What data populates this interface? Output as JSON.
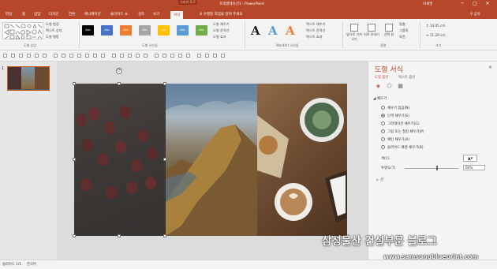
{
  "window": {
    "context_tab": "그리기 도구",
    "title": "프레젠테이션1 - PowerPoint",
    "user": "이세영",
    "min": "─",
    "max": "□",
    "close": "✕"
  },
  "tabs": [
    "파일",
    "홈",
    "삽입",
    "디자인",
    "전환",
    "애니메이션",
    "슬라이드 쇼",
    "검토",
    "보기",
    "서식"
  ],
  "tell_me": "수행할 작업을 알려 주세요",
  "share": "공유",
  "ribbon": {
    "shape_fill": "도형 채우기",
    "shape_outline": "도형 윤곽선",
    "shape_effects": "도형 효과",
    "edit_shape": "도형 편집",
    "text_box": "텍스트 상자",
    "merge_shapes": "도형 병합",
    "insert_shapes_label": "도형 삽입",
    "style_swatch_text": "Abc",
    "shape_styles_label": "도형 스타일",
    "wordart_letter": "A",
    "text_fill": "텍스트 채우기",
    "text_outline": "텍스트 윤곽선",
    "text_effects": "텍스트 효과",
    "wordart_label": "WordArt 스타일",
    "bring_forward": "앞으로 가져오기",
    "send_backward": "뒤로 보내기",
    "selection_pane": "선택 창",
    "align": "맞춤",
    "group": "그룹화",
    "rotate": "회전",
    "arrange_label": "정렬",
    "height": "10.05 cm",
    "width": "11.29 cm",
    "size_label": "크기"
  },
  "thumbnail_number": "1",
  "watermark": "삼성물산 건설부문 블로그",
  "watermark_url": "www.samsungblueprint.com",
  "pane": {
    "title": "도형 서식",
    "close": "✕",
    "tab_shape": "도형 옵션",
    "tab_text": "텍스트 옵션",
    "fill_section": "◢ 채우기",
    "options": [
      "채우기 없음(N)",
      "단색 채우기(S)",
      "그라데이션 채우기(G)",
      "그림 또는 질감 채우기(P)",
      "패턴 채우기(A)",
      "슬라이드 배경 채우기(B)"
    ],
    "selected_option": 1,
    "color_label": "색(C)",
    "transparency_label": "투명도(T)",
    "transparency_value": "60%",
    "transparency": 0.6,
    "line_section": "▷ 선"
  },
  "status": {
    "slide": "슬라이드 1/1",
    "language": "한국어"
  },
  "colors": {
    "accent": "#b7472a",
    "swatches": [
      "#000000",
      "#4472c4",
      "#ed7d31",
      "#a5a5a5",
      "#ffc000",
      "#5b9bd5",
      "#70ad47"
    ],
    "wordart": [
      "#1f1f1f",
      "#5b9bd5",
      "#ed7d31"
    ]
  }
}
